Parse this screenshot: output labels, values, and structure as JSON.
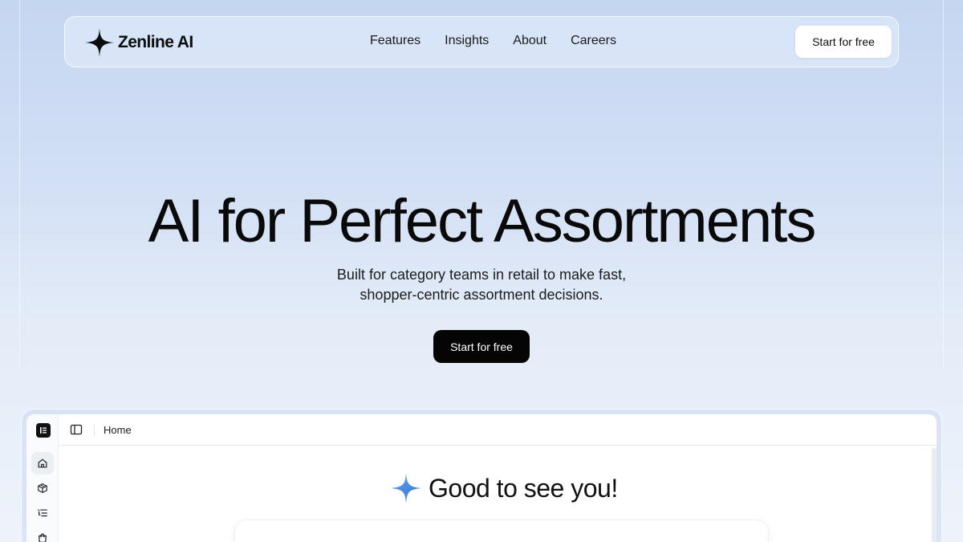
{
  "brand": {
    "name": "Zenline AI",
    "logo_icon": "four-point-star-icon"
  },
  "nav": {
    "links": [
      "Features",
      "Insights",
      "About",
      "Careers"
    ],
    "cta_label": "Start for free"
  },
  "hero": {
    "title": "AI for Perfect Assortments",
    "subtitle_line1": "Built for category teams in retail to make fast,",
    "subtitle_line2": "shopper-centric assortment decisions.",
    "cta_label": "Start for free"
  },
  "app_preview": {
    "breadcrumb": "Home",
    "greeting": "Good to see you!",
    "greeting_icon": "sparkle-icon",
    "sidebar_icons": [
      "home-icon",
      "package-icon",
      "list-icon",
      "shopping-bag-icon"
    ],
    "accent_color": "#3b7ddd"
  }
}
